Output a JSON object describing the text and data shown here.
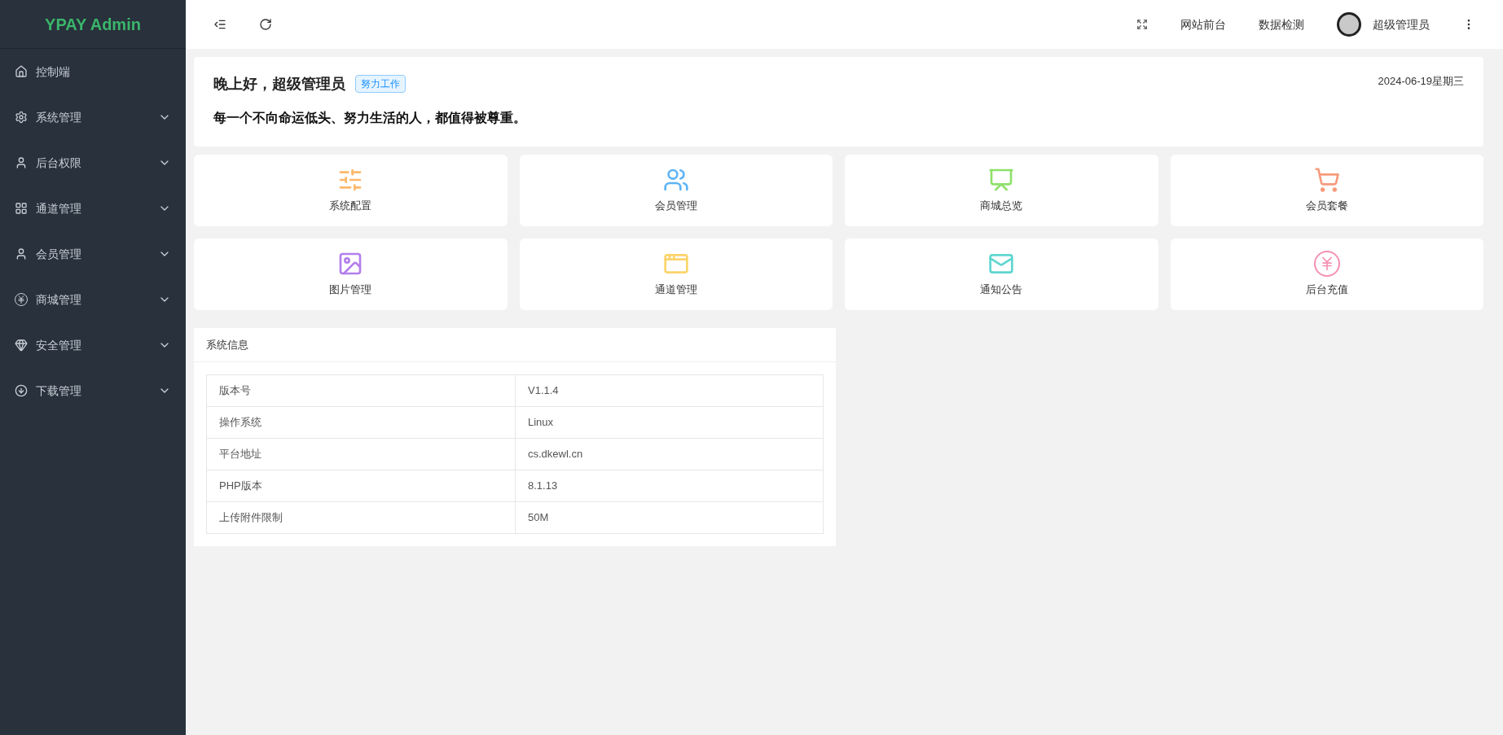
{
  "sidebar": {
    "logo": "YPAY Admin",
    "items": [
      {
        "label": "控制端",
        "kind": "home",
        "expandable": false
      },
      {
        "label": "系统管理",
        "kind": "gear",
        "expandable": true
      },
      {
        "label": "后台权限",
        "kind": "user",
        "expandable": true
      },
      {
        "label": "通道管理",
        "kind": "grid",
        "expandable": true
      },
      {
        "label": "会员管理",
        "kind": "user",
        "expandable": true
      },
      {
        "label": "商城管理",
        "kind": "yen",
        "expandable": true
      },
      {
        "label": "安全管理",
        "kind": "gem",
        "expandable": true
      },
      {
        "label": "下载管理",
        "kind": "download",
        "expandable": true
      }
    ]
  },
  "header": {
    "links": [
      "网站前台",
      "数据检测"
    ],
    "user": "超级管理员"
  },
  "greeting": {
    "title": "晚上好，超级管理员",
    "tag": "努力工作",
    "date": "2024-06-19星期三",
    "motto": "每一个不向命运低头、努力生活的人，都值得被尊重。"
  },
  "shortcuts": [
    {
      "label": "系统配置",
      "kind": "sliders",
      "color": "#fcb86b"
    },
    {
      "label": "会员管理",
      "kind": "users",
      "color": "#5eb4f5"
    },
    {
      "label": "商城总览",
      "kind": "presentation",
      "color": "#8fe06b"
    },
    {
      "label": "会员套餐",
      "kind": "cart",
      "color": "#f79a7c"
    },
    {
      "label": "图片管理",
      "kind": "image",
      "color": "#b37feb"
    },
    {
      "label": "通道管理",
      "kind": "window",
      "color": "#fdd46b"
    },
    {
      "label": "通知公告",
      "kind": "mail",
      "color": "#5ed6cf"
    },
    {
      "label": "后台充值",
      "kind": "yen",
      "color": "#f78fb3"
    }
  ],
  "system_info": {
    "title": "系统信息",
    "rows": [
      {
        "label": "版本号",
        "value": "V1.1.4"
      },
      {
        "label": "操作系统",
        "value": "Linux"
      },
      {
        "label": "平台地址",
        "value": "cs.dkewl.cn"
      },
      {
        "label": "PHP版本",
        "value": "8.1.13"
      },
      {
        "label": "上传附件限制",
        "value": "50M"
      }
    ]
  }
}
